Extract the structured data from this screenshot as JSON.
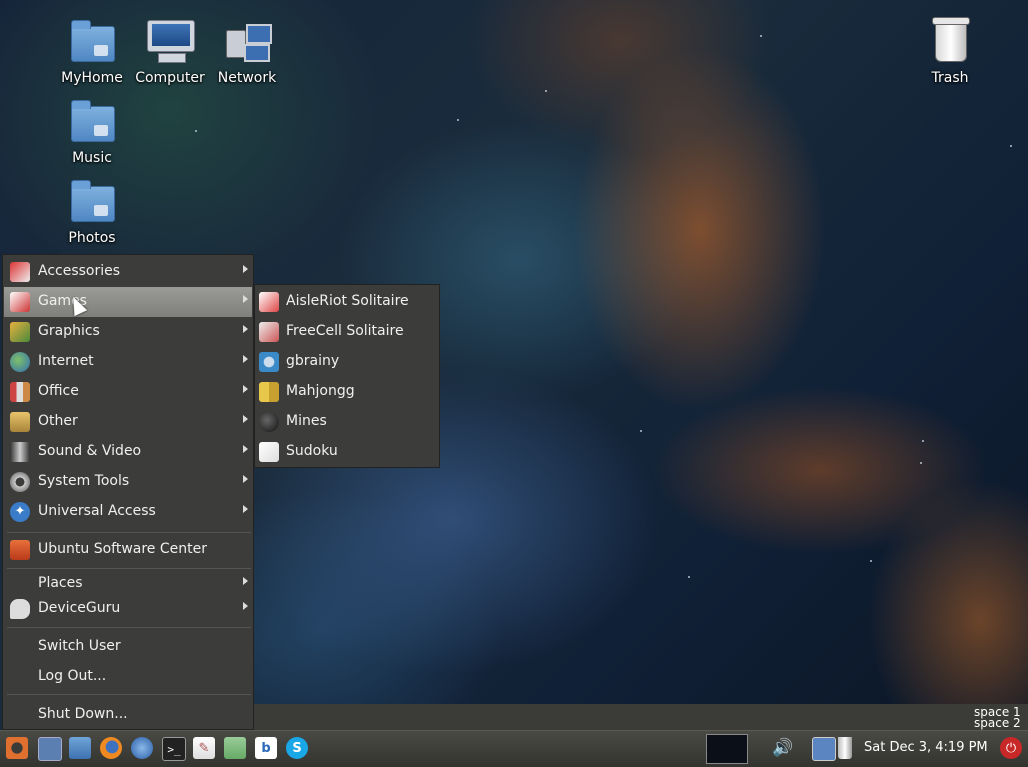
{
  "desktop": {
    "icons": [
      {
        "label": "MyHome"
      },
      {
        "label": "Computer"
      },
      {
        "label": "Network"
      },
      {
        "label": "Trash"
      },
      {
        "label": "Music"
      },
      {
        "label": "Photos"
      }
    ]
  },
  "main_menu": {
    "items": [
      {
        "label": "Accessories",
        "icon": "accessories-icon",
        "submenu": true
      },
      {
        "label": "Games",
        "icon": "games-icon",
        "submenu": true,
        "active": true
      },
      {
        "label": "Graphics",
        "icon": "graphics-icon",
        "submenu": true
      },
      {
        "label": "Internet",
        "icon": "internet-icon",
        "submenu": true
      },
      {
        "label": "Office",
        "icon": "office-icon",
        "submenu": true
      },
      {
        "label": "Other",
        "icon": "other-icon",
        "submenu": true
      },
      {
        "label": "Sound & Video",
        "icon": "sound-video-icon",
        "submenu": true
      },
      {
        "label": "System Tools",
        "icon": "system-tools-icon",
        "submenu": true
      },
      {
        "label": "Universal Access",
        "icon": "universal-access-icon",
        "submenu": true
      }
    ],
    "software_center": "Ubuntu Software Center",
    "places": "Places",
    "deviceguru": "DeviceGuru",
    "switch_user": "Switch User",
    "log_out": "Log Out...",
    "shut_down": "Shut Down..."
  },
  "games_submenu": {
    "items": [
      {
        "label": "AisleRiot Solitaire",
        "icon": "aisleriot-icon"
      },
      {
        "label": "FreeCell Solitaire",
        "icon": "freecell-icon"
      },
      {
        "label": "gbrainy",
        "icon": "gbrainy-icon"
      },
      {
        "label": "Mahjongg",
        "icon": "mahjongg-icon"
      },
      {
        "label": "Mines",
        "icon": "mines-icon"
      },
      {
        "label": "Sudoku",
        "icon": "sudoku-icon"
      }
    ]
  },
  "workspaces": {
    "space1": "space 1",
    "space2": "space 2"
  },
  "taskbar": {
    "clock": "Sat Dec  3,  4:19 PM"
  },
  "colors": {
    "menu_bg": "#3c3c3a",
    "menu_highlight": "#8c8c88",
    "panel_bg": "#3b3b37"
  }
}
